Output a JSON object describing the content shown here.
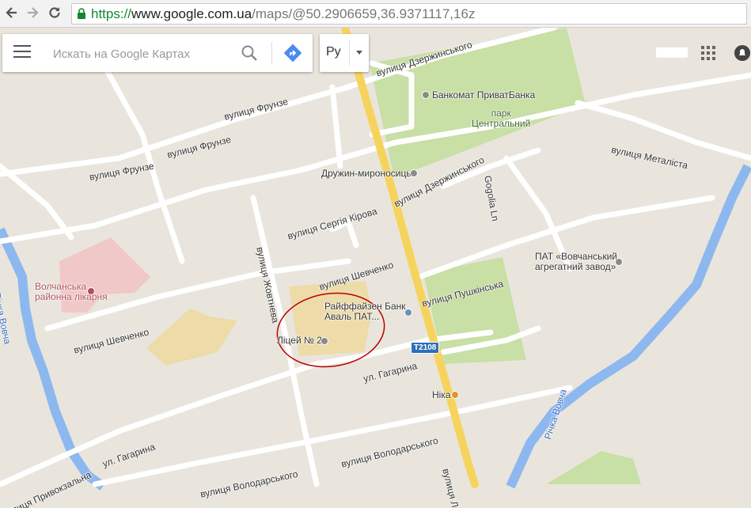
{
  "browser": {
    "url_scheme": "https://",
    "url_host": "www.google.com.ua",
    "url_path": "/maps/@50.2906659,36.9371117,16z"
  },
  "search": {
    "placeholder": "Искать на Google Картах"
  },
  "language": {
    "label": "Ру"
  },
  "map": {
    "colors": {
      "land": "#e9e5dc",
      "road": "#ffffff",
      "highway": "#f6d35c",
      "park": "#c8dfa5",
      "river": "#8db8ef",
      "hospital": "#f0c8c8",
      "school": "#eddba8",
      "annotation": "#b80000"
    },
    "streets": {
      "dzerzhynskoho_top": "вулиця Дзержинського",
      "frunze_top": "вулиця Фрунзе",
      "frunze_mid": "вулиця Фрунзе",
      "frunze_left": "вулиця Фрунзе",
      "metalista": "вулиця Металіста",
      "dzerzhynskoho_mid": "вулиця Дзержинського",
      "gogolia": "Gogolia Ln",
      "kirova": "вулиця Сергія Кірова",
      "zhovtneva": "вулиця Жовтнева",
      "shevchenko_mid": "вулиця Шевченко",
      "shevchenko_left": "вулиця Шевченко",
      "pushkinska": "вулиця Пушкінська",
      "gagarina_mid": "ул. Гагарина",
      "gagarina_left": "ул. Гагарина",
      "pryvokzalna": "вулиця Привокзальна",
      "volodarskoho_mid": "вулиця Володарського",
      "volodarskoho_left": "вулиця Володарського",
      "lenina": "вулиця Ле"
    },
    "places": {
      "bank_atm": "Банкомат ПриватБанка",
      "park": "парк\nЦентральний",
      "druzhyn": "Дружин-мироносиць",
      "hospital": "Волчанська\nрайонна лікарня",
      "factory": "ПАТ «Вовчанський\nагрегатний завод»",
      "raiffeisen": "Райффайзен Банк\nАваль ПАТ...",
      "lyceum": "Ліцей № 2",
      "nika": "Ніка"
    },
    "rivers": {
      "left": "Річка Вовча",
      "right": "Річка Вовча"
    },
    "road_shield": "Т2108"
  }
}
